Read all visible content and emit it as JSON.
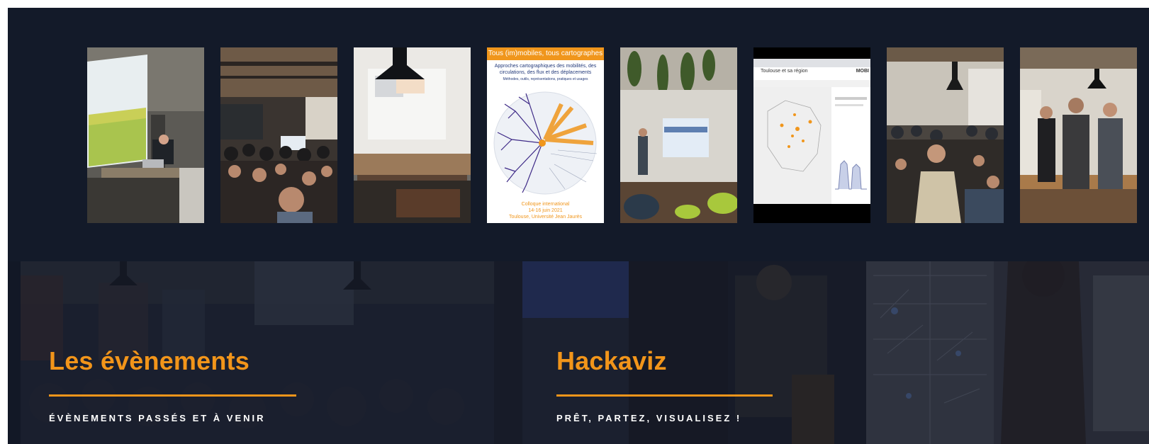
{
  "gallery": {
    "poster": {
      "title": "Tous (im)mobiles, tous cartographes",
      "subtitle": "Approches cartographiques des mobilités, des circulations, des flux et des déplacements",
      "methods": "Méthodes, outils, représentations, pratiques et usages",
      "event": "Colloque international",
      "dates": "14-16 juin 2021",
      "place": "Toulouse, Université Jean Jaurès"
    },
    "map_screenshot": {
      "heading": "Toulouse et sa région",
      "brand": "MOBI"
    }
  },
  "panels": [
    {
      "title": "Les évènements",
      "subtitle": "ÉVÈNEMENTS PASSÉS ET À VENIR"
    },
    {
      "title": "Hackaviz",
      "subtitle": "PRÊT, PARTEZ, VISUALISEZ !"
    },
    {
      "title": "",
      "subtitle": ""
    }
  ],
  "colors": {
    "accent": "#f2951a",
    "background": "#121826"
  }
}
